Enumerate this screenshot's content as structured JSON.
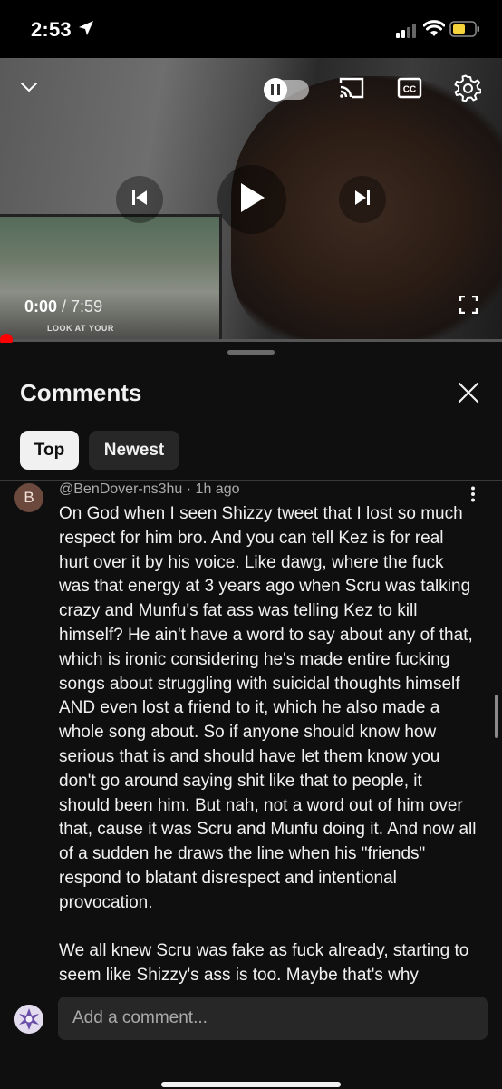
{
  "status_bar": {
    "time": "2:53",
    "icons": [
      "location-arrow-icon",
      "signal-icon",
      "wifi-icon",
      "battery-icon"
    ],
    "battery_color": "#f5d33a"
  },
  "player": {
    "current_time": "0:00",
    "duration": "/ 7:59",
    "progress": 0.0,
    "accent_color": "#ff0000",
    "inset_caption": "LOOK AT YOUR",
    "controls": [
      "collapse-icon",
      "autoplay-toggle",
      "cast-icon",
      "cc-icon",
      "settings-icon",
      "previous-icon",
      "play-icon",
      "next-icon",
      "fullscreen-icon"
    ]
  },
  "comments_panel": {
    "title": "Comments",
    "filters": [
      "Top",
      "Newest"
    ],
    "selected_filter": "Top",
    "comment": {
      "avatar_letter": "B",
      "author": "@BenDover-ns3hu",
      "age": "1h ago",
      "paragraphs": [
        "On God when I seen Shizzy tweet that I lost so much respect for him bro.  And you can tell Kez is for real hurt over it by his voice.  Like dawg, where the fuck was that energy at 3 years ago when Scru was talking crazy and Munfu's fat ass was telling Kez to kill himself?  He ain't have a word to say about any of that, which is ironic considering he's made entire fucking songs about struggling with suicidal thoughts himself AND even lost a friend to it, which he also made a whole song about. So if anyone should know how serious that is and should have let them know you don't go around saying shit like that to people, it should been him.  But nah, not a word out of him over that, cause it was Scru and Munfu doing it.  And now all of a sudden he draws the line when his \"friends\" respond to blatant disrespect and intentional provocation.",
        "We all knew Scru was fake as fuck already, starting to seem like Shizzy's ass is too.  Maybe that's why"
      ]
    },
    "composer_placeholder": "Add a comment..."
  }
}
